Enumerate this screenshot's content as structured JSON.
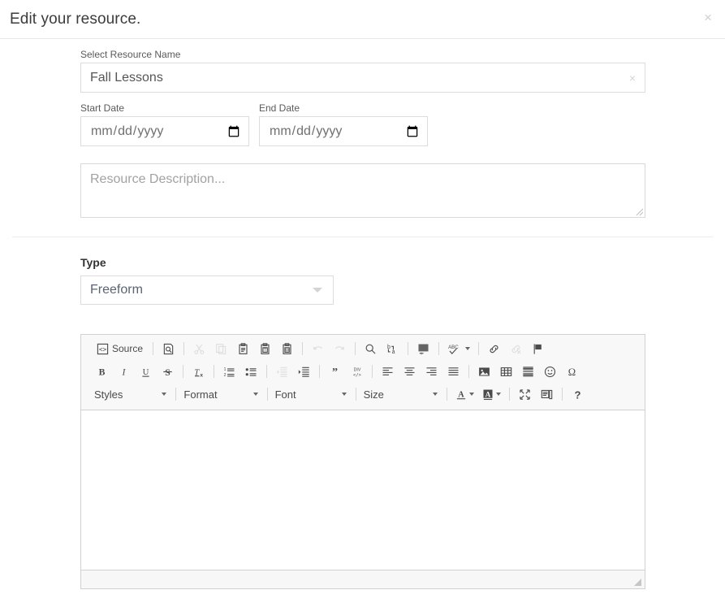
{
  "header": {
    "title": "Edit your resource.",
    "close_label": "×"
  },
  "form": {
    "resource_name": {
      "label": "Select Resource Name",
      "value": "Fall Lessons",
      "clear_label": "×"
    },
    "start_date": {
      "label": "Start Date",
      "placeholder": "mm/dd/yyyy",
      "value": ""
    },
    "end_date": {
      "label": "End Date",
      "placeholder": "mm/dd/yyyy",
      "value": ""
    },
    "description": {
      "placeholder": "Resource Description...",
      "value": ""
    },
    "type": {
      "label": "Type",
      "value": "Freeform",
      "options": [
        "Freeform"
      ]
    }
  },
  "editor": {
    "content": "",
    "toolbar_rows": [
      [
        {
          "name": "source-button",
          "label": "Source",
          "icon": "source-icon",
          "kind": "button-with-label",
          "disabled": false
        },
        {
          "name": "separator",
          "kind": "separator"
        },
        {
          "name": "preview-button",
          "label": "Preview",
          "icon": "preview-icon",
          "kind": "button",
          "disabled": false
        },
        {
          "name": "separator",
          "kind": "separator"
        },
        {
          "name": "cut-button",
          "label": "Cut",
          "icon": "scissors-icon",
          "kind": "button",
          "disabled": true
        },
        {
          "name": "copy-button",
          "label": "Copy",
          "icon": "copy-icon",
          "kind": "button",
          "disabled": true
        },
        {
          "name": "paste-button",
          "label": "Paste",
          "icon": "paste-icon",
          "kind": "button",
          "disabled": false
        },
        {
          "name": "paste-text-button",
          "label": "Paste as plain text",
          "icon": "paste-text-icon",
          "kind": "button",
          "disabled": false
        },
        {
          "name": "paste-word-button",
          "label": "Paste from Word",
          "icon": "paste-word-icon",
          "kind": "button",
          "disabled": false
        },
        {
          "name": "separator",
          "kind": "separator"
        },
        {
          "name": "undo-button",
          "label": "Undo",
          "icon": "undo-icon",
          "kind": "button",
          "disabled": true
        },
        {
          "name": "redo-button",
          "label": "Redo",
          "icon": "redo-icon",
          "kind": "button",
          "disabled": true
        },
        {
          "name": "separator",
          "kind": "separator"
        },
        {
          "name": "find-button",
          "label": "Find",
          "icon": "magnifier-icon",
          "kind": "button",
          "disabled": false
        },
        {
          "name": "replace-button",
          "label": "Replace",
          "icon": "replace-icon",
          "kind": "button",
          "disabled": false
        },
        {
          "name": "separator",
          "kind": "separator"
        },
        {
          "name": "select-all-button",
          "label": "Select All",
          "icon": "select-all-icon",
          "kind": "button",
          "disabled": false
        },
        {
          "name": "separator",
          "kind": "separator"
        },
        {
          "name": "spellcheck-button",
          "label": "Spell Check As You Type",
          "icon": "spellcheck-icon",
          "kind": "button-with-caret",
          "disabled": false
        },
        {
          "name": "separator",
          "kind": "separator"
        },
        {
          "name": "link-button",
          "label": "Link",
          "icon": "link-icon",
          "kind": "button",
          "disabled": false
        },
        {
          "name": "unlink-button",
          "label": "Unlink",
          "icon": "unlink-icon",
          "kind": "button",
          "disabled": true
        },
        {
          "name": "anchor-button",
          "label": "Anchor",
          "icon": "flag-icon",
          "kind": "button",
          "disabled": false
        }
      ],
      [
        {
          "name": "bold-button",
          "label": "Bold",
          "icon": "bold-icon",
          "kind": "button",
          "disabled": false
        },
        {
          "name": "italic-button",
          "label": "Italic",
          "icon": "italic-icon",
          "kind": "button",
          "disabled": false
        },
        {
          "name": "underline-button",
          "label": "Underline",
          "icon": "underline-icon",
          "kind": "button",
          "disabled": false
        },
        {
          "name": "strike-button",
          "label": "Strikethrough",
          "icon": "strikethrough-icon",
          "kind": "button",
          "disabled": false
        },
        {
          "name": "separator",
          "kind": "separator"
        },
        {
          "name": "remove-format-button",
          "label": "Remove Format",
          "icon": "remove-format-icon",
          "kind": "button",
          "disabled": false
        },
        {
          "name": "separator",
          "kind": "separator"
        },
        {
          "name": "numbered-list-button",
          "label": "Insert/Remove Numbered List",
          "icon": "numbered-list-icon",
          "kind": "button",
          "disabled": false
        },
        {
          "name": "bulleted-list-button",
          "label": "Insert/Remove Bulleted List",
          "icon": "bulleted-list-icon",
          "kind": "button",
          "disabled": false
        },
        {
          "name": "separator",
          "kind": "separator"
        },
        {
          "name": "outdent-button",
          "label": "Decrease Indent",
          "icon": "outdent-icon",
          "kind": "button",
          "disabled": true
        },
        {
          "name": "indent-button",
          "label": "Increase Indent",
          "icon": "indent-icon",
          "kind": "button",
          "disabled": false
        },
        {
          "name": "separator",
          "kind": "separator"
        },
        {
          "name": "blockquote-button",
          "label": "Block Quote",
          "icon": "blockquote-icon",
          "kind": "button",
          "disabled": false
        },
        {
          "name": "div-button",
          "label": "Create Div Container",
          "icon": "div-container-icon",
          "kind": "button",
          "disabled": false
        },
        {
          "name": "separator",
          "kind": "separator"
        },
        {
          "name": "align-left-button",
          "label": "Align Left",
          "icon": "align-left-icon",
          "kind": "button",
          "disabled": false
        },
        {
          "name": "align-center-button",
          "label": "Center",
          "icon": "align-center-icon",
          "kind": "button",
          "disabled": false
        },
        {
          "name": "align-right-button",
          "label": "Align Right",
          "icon": "align-right-icon",
          "kind": "button",
          "disabled": false
        },
        {
          "name": "align-justify-button",
          "label": "Justify",
          "icon": "align-justify-icon",
          "kind": "button",
          "disabled": false
        },
        {
          "name": "separator",
          "kind": "separator"
        },
        {
          "name": "image-button",
          "label": "Image",
          "icon": "image-icon",
          "kind": "button",
          "disabled": false
        },
        {
          "name": "table-button",
          "label": "Table",
          "icon": "table-icon",
          "kind": "button",
          "disabled": false
        },
        {
          "name": "horizontal-rule-button",
          "label": "Insert Horizontal Line",
          "icon": "horizontal-rule-icon",
          "kind": "button",
          "disabled": false
        },
        {
          "name": "smiley-button",
          "label": "Smiley",
          "icon": "smiley-icon",
          "kind": "button",
          "disabled": false
        },
        {
          "name": "special-char-button",
          "label": "Insert Special Character",
          "icon": "omega-icon",
          "kind": "button",
          "disabled": false
        }
      ],
      [
        {
          "name": "styles-combo",
          "label": "Styles",
          "kind": "combo",
          "disabled": false
        },
        {
          "name": "separator",
          "kind": "separator"
        },
        {
          "name": "format-combo",
          "label": "Format",
          "kind": "combo",
          "disabled": false
        },
        {
          "name": "separator",
          "kind": "separator"
        },
        {
          "name": "font-combo",
          "label": "Font",
          "kind": "combo",
          "disabled": false
        },
        {
          "name": "separator",
          "kind": "separator"
        },
        {
          "name": "size-combo",
          "label": "Size",
          "kind": "combo",
          "disabled": false
        },
        {
          "name": "separator",
          "kind": "separator"
        },
        {
          "name": "text-color-button",
          "label": "Text Color",
          "icon": "text-color-icon",
          "kind": "button-with-caret",
          "disabled": false
        },
        {
          "name": "bg-color-button",
          "label": "Background Color",
          "icon": "background-color-icon",
          "kind": "button-with-caret",
          "disabled": false
        },
        {
          "name": "separator",
          "kind": "separator"
        },
        {
          "name": "maximize-button",
          "label": "Maximize",
          "icon": "maximize-icon",
          "kind": "button",
          "disabled": false
        },
        {
          "name": "show-blocks-button",
          "label": "Show Blocks",
          "icon": "show-blocks-icon",
          "kind": "button",
          "disabled": false
        },
        {
          "name": "separator",
          "kind": "separator"
        },
        {
          "name": "about-button",
          "label": "About CKEditor",
          "icon": "question-icon",
          "kind": "button",
          "disabled": false
        }
      ]
    ]
  },
  "colors": {
    "border": "#dcdcdc",
    "toolbar_bg": "#f8f8f8",
    "footer_bg": "#f7f7f7",
    "text": "#333333",
    "muted": "#a2a2a2"
  }
}
